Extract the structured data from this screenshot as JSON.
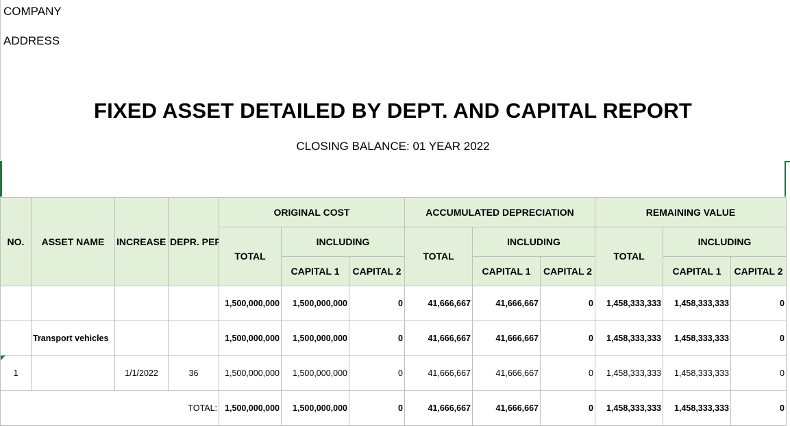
{
  "header": {
    "company": "COMPANY",
    "address": "ADDRESS",
    "title": "FIXED ASSET DETAILED BY DEPT. AND CAPITAL REPORT",
    "subtitle": "CLOSING BALANCE: 01 YEAR 2022"
  },
  "columns": {
    "no": "NO.",
    "asset_name": "ASSET NAME",
    "increase_date": "INCREASE DATE",
    "depr_periods": "DEPR. PERIODS (MONTH)",
    "original_cost": "ORIGINAL COST",
    "accumulated_depreciation": "ACCUMULATED DEPRECIATION",
    "remaining_value": "REMAINING VALUE",
    "total": "TOTAL",
    "including": "INCLUDING",
    "capital_1": "CAPITAL 1",
    "capital_2": "CAPITAL 2"
  },
  "rows": [
    {
      "no": "",
      "asset_name": "",
      "increase_date": "",
      "depr_periods": "",
      "oc_total": "1,500,000,000",
      "oc_cap1": "1,500,000,000",
      "oc_cap2": "0",
      "ad_total": "41,666,667",
      "ad_cap1": "41,666,667",
      "ad_cap2": "0",
      "rv_total": "1,458,333,333",
      "rv_cap1": "1,458,333,333",
      "rv_cap2": "0"
    },
    {
      "no": "",
      "asset_name": "Transport vehicles",
      "increase_date": "",
      "depr_periods": "",
      "oc_total": "1,500,000,000",
      "oc_cap1": "1,500,000,000",
      "oc_cap2": "0",
      "ad_total": "41,666,667",
      "ad_cap1": "41,666,667",
      "ad_cap2": "0",
      "rv_total": "1,458,333,333",
      "rv_cap1": "1,458,333,333",
      "rv_cap2": "0"
    },
    {
      "no": "1",
      "asset_name": "",
      "increase_date": "1/1/2022",
      "depr_periods": "36",
      "oc_total": "1,500,000,000",
      "oc_cap1": "1,500,000,000",
      "oc_cap2": "0",
      "ad_total": "41,666,667",
      "ad_cap1": "41,666,667",
      "ad_cap2": "0",
      "rv_total": "1,458,333,333",
      "rv_cap1": "1,458,333,333",
      "rv_cap2": "0"
    }
  ],
  "totals": {
    "label": "TOTAL:",
    "oc_total": "1,500,000,000",
    "oc_cap1": "1,500,000,000",
    "oc_cap2": "0",
    "ad_total": "41,666,667",
    "ad_cap1": "41,666,667",
    "ad_cap2": "0",
    "rv_total": "1,458,333,333",
    "rv_cap1": "1,458,333,333",
    "rv_cap2": "0"
  },
  "colors": {
    "header_fill": "#e2f0da",
    "gridline": "#bfbfbf",
    "selection": "#217346"
  }
}
